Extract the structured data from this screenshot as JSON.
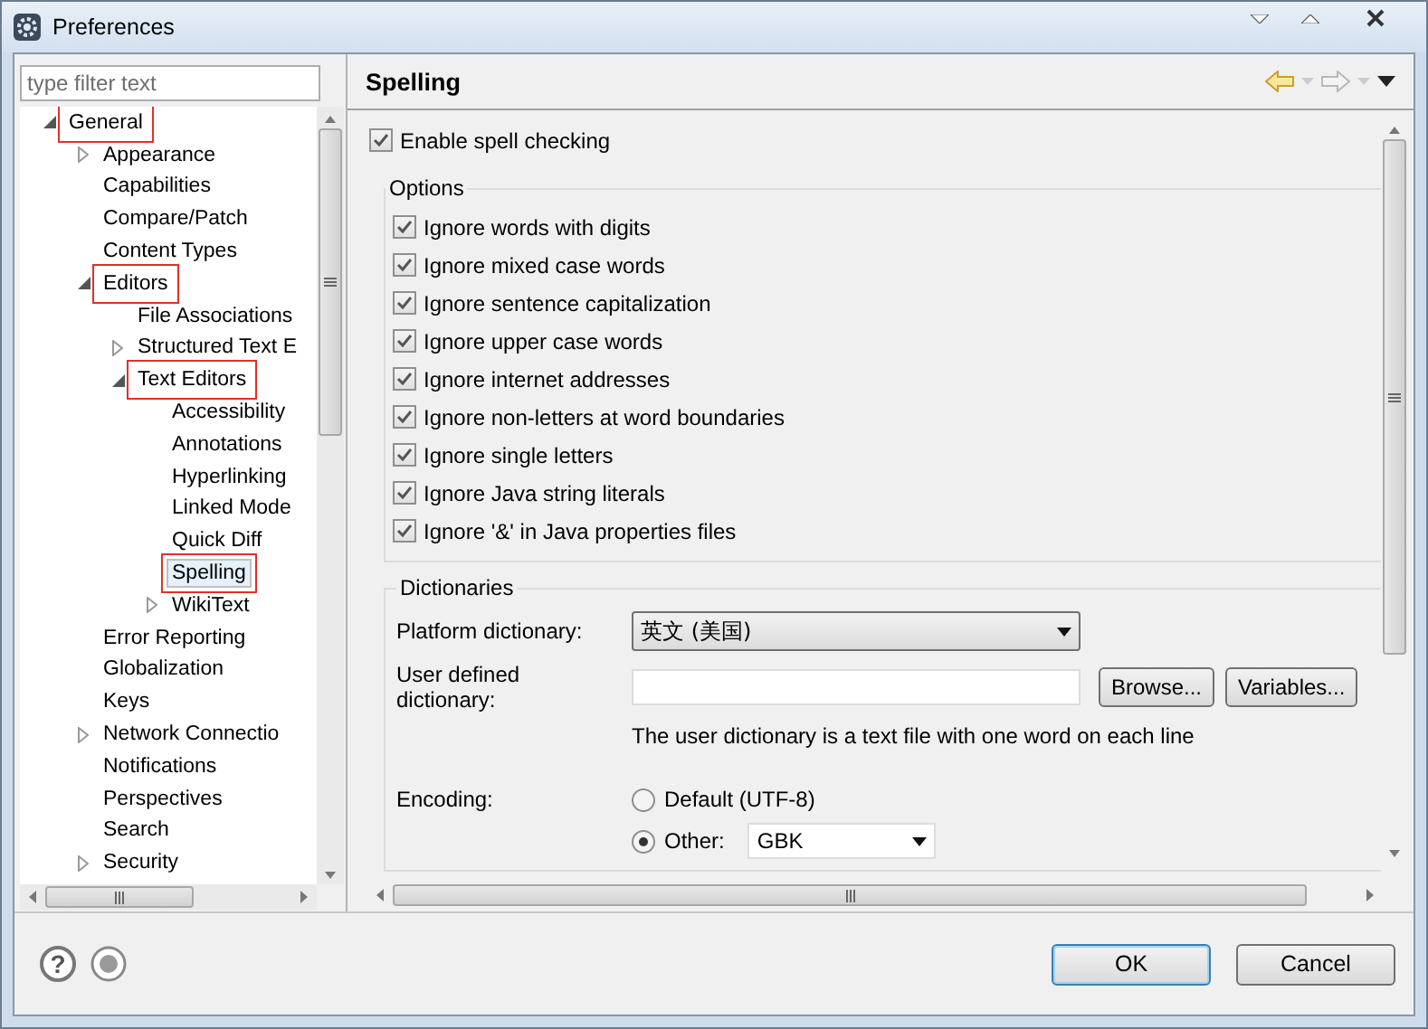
{
  "window": {
    "title": "Preferences"
  },
  "filter": {
    "placeholder": "type filter text"
  },
  "tree": [
    {
      "label": "General",
      "expanded": true,
      "selected": false,
      "annotated": true,
      "children": [
        {
          "label": "Appearance",
          "expanded": false,
          "selected": false,
          "annotated": false
        },
        {
          "label": "Capabilities",
          "selected": false,
          "annotated": false
        },
        {
          "label": "Compare/Patch",
          "selected": false,
          "annotated": false
        },
        {
          "label": "Content Types",
          "selected": false,
          "annotated": false
        },
        {
          "label": "Editors",
          "expanded": true,
          "selected": false,
          "annotated": true,
          "children": [
            {
              "label": "File Associations",
              "selected": false,
              "annotated": false
            },
            {
              "label": "Structured Text E",
              "expanded": false,
              "selected": false,
              "annotated": false
            },
            {
              "label": "Text Editors",
              "expanded": true,
              "selected": false,
              "annotated": true,
              "children": [
                {
                  "label": "Accessibility",
                  "selected": false,
                  "annotated": false
                },
                {
                  "label": "Annotations",
                  "selected": false,
                  "annotated": false
                },
                {
                  "label": "Hyperlinking",
                  "selected": false,
                  "annotated": false
                },
                {
                  "label": "Linked Mode",
                  "selected": false,
                  "annotated": false
                },
                {
                  "label": "Quick Diff",
                  "selected": false,
                  "annotated": false
                },
                {
                  "label": "Spelling",
                  "selected": true,
                  "annotated": true
                },
                {
                  "label": "WikiText",
                  "expanded": false,
                  "selected": false,
                  "annotated": false
                }
              ]
            }
          ]
        },
        {
          "label": "Error Reporting",
          "selected": false,
          "annotated": false
        },
        {
          "label": "Globalization",
          "selected": false,
          "annotated": false
        },
        {
          "label": "Keys",
          "selected": false,
          "annotated": false
        },
        {
          "label": "Network Connectio",
          "expanded": false,
          "selected": false,
          "annotated": false
        },
        {
          "label": "Notifications",
          "selected": false,
          "annotated": false
        },
        {
          "label": "Perspectives",
          "selected": false,
          "annotated": false
        },
        {
          "label": "Search",
          "selected": false,
          "annotated": false
        },
        {
          "label": "Security",
          "expanded": false,
          "selected": false,
          "annotated": false
        }
      ]
    }
  ],
  "page": {
    "title": "Spelling"
  },
  "enable_spell_checking": {
    "label": "Enable spell checking",
    "checked": true
  },
  "options": {
    "title": "Options",
    "items": [
      {
        "label": "Ignore words with digits",
        "checked": true
      },
      {
        "label": "Ignore mixed case words",
        "checked": true
      },
      {
        "label": "Ignore sentence capitalization",
        "checked": true
      },
      {
        "label": "Ignore upper case words",
        "checked": true
      },
      {
        "label": "Ignore internet addresses",
        "checked": true
      },
      {
        "label": "Ignore non-letters at word boundaries",
        "checked": true
      },
      {
        "label": "Ignore single letters",
        "checked": true
      },
      {
        "label": "Ignore Java string literals",
        "checked": true
      },
      {
        "label": "Ignore '&' in Java properties files",
        "checked": true
      }
    ]
  },
  "dictionaries": {
    "title": "Dictionaries",
    "platform_dictionary": {
      "label": "Platform dictionary:",
      "value": "英文 (美国)"
    },
    "user_dictionary": {
      "label": "User defined dictionary:"
    },
    "browse_button": "Browse...",
    "variables_button": "Variables...",
    "note": "The user dictionary is a text file with one word on each line",
    "encoding": {
      "label": "Encoding:",
      "options": [
        {
          "label": "Default (UTF-8)",
          "selected": false
        },
        {
          "label": "Other:",
          "selected": true
        }
      ],
      "other_value": "GBK"
    }
  },
  "help_glyph": "?",
  "buttons": [
    {
      "label": "OK"
    },
    {
      "label": "Cancel"
    }
  ]
}
